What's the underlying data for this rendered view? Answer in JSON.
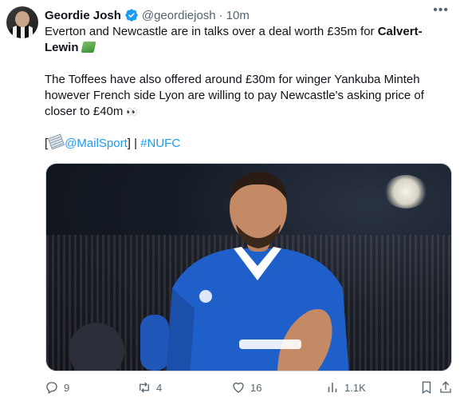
{
  "author": {
    "name": "Geordie Josh",
    "handle": "@geordiejosh",
    "separator": "·",
    "time": "10m",
    "verified_icon": "verified-badge-icon",
    "accent": "#1d9bf0"
  },
  "tweet": {
    "line1_prefix": "Everton and Newcastle are in talks over a deal worth £35m for ",
    "line1_bold_a": "Calvert-",
    "line1_bold_b": "Lewin",
    "line1_emoji": "money-with-wings",
    "para2": "The Toffees have also offered around £30m for winger Yankuba Minteh however French side Lyon are willing to pay Newcastle's asking price of closer to £40m",
    "para2_emoji": "eyes",
    "source_open": "[",
    "source_emoji": "newspaper",
    "source_mention": "@MailSport",
    "source_close": "] | ",
    "hashtag": "#NUFC"
  },
  "media": {
    "kind": "photo",
    "subject": "footballer in blue kit celebrating"
  },
  "actions": {
    "replies": "9",
    "reposts": "4",
    "likes": "16",
    "views": "1.1K",
    "icons": [
      "reply-icon",
      "repost-icon",
      "like-icon",
      "views-icon",
      "bookmark-icon",
      "share-icon"
    ],
    "color": "#536471"
  }
}
